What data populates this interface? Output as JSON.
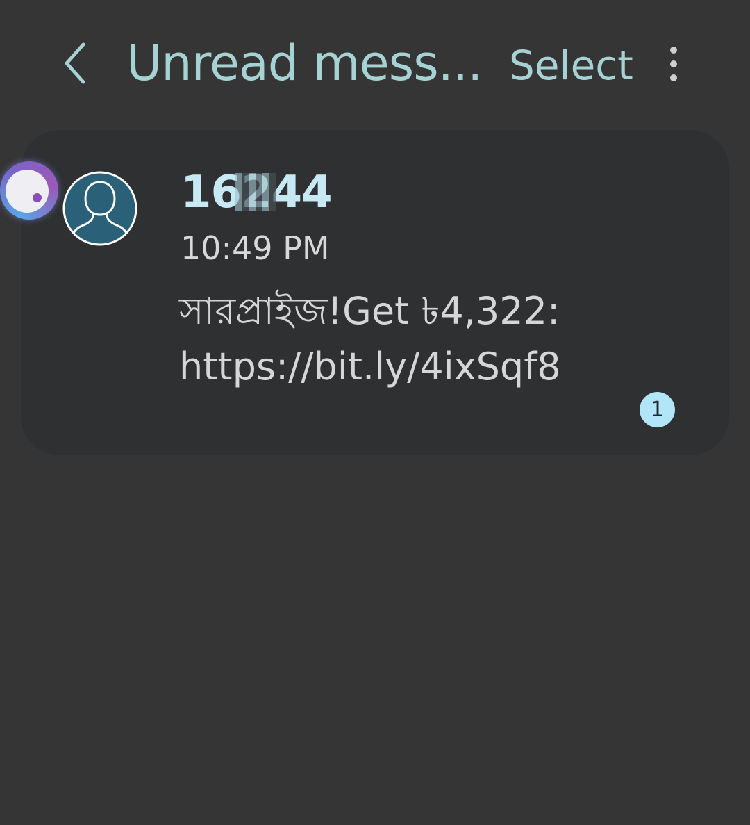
{
  "header": {
    "title": "Unread mess...",
    "select_label": "Select",
    "back_icon": "chevron-left-icon",
    "more_icon": "more-vertical-icon"
  },
  "conversation": {
    "sender": "16244",
    "time": "10:49 PM",
    "message": "সারপ্রাইজ!Get ৳4,322: https://bit.ly/4ixSqf8",
    "unread_count": "1",
    "avatar_icon": "person-silhouette-icon"
  },
  "colors": {
    "background": "#353535",
    "card": "#2e3032",
    "accent": "#a7d2d4",
    "badge": "#b3e5f8"
  }
}
